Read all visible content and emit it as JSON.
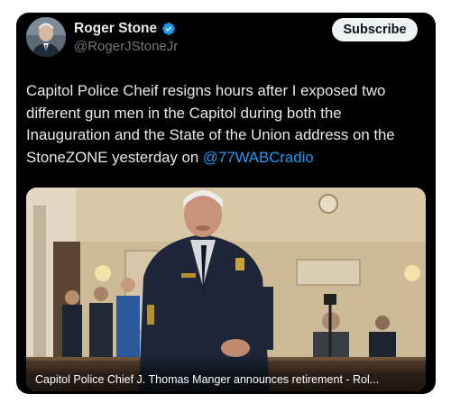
{
  "author": {
    "display_name": "Roger Stone",
    "handle": "@RogerJStoneJr",
    "verified": true
  },
  "subscribe_label": "Subscribe",
  "tweet": {
    "text": "Capitol Police Cheif resigns hours after I exposed two different gun men in the Capitol during both the Inauguration and the State of the Union address on the StoneZONE yesterday on ",
    "mention": "@77WABCradio"
  },
  "media": {
    "caption": "Capitol Police Chief J. Thomas Manger announces retirement - Rol..."
  },
  "colors": {
    "background": "#000000",
    "text": "#e7e9ea",
    "muted": "#71767b",
    "link": "#1d9bf0",
    "button_bg": "#eff3f4"
  }
}
